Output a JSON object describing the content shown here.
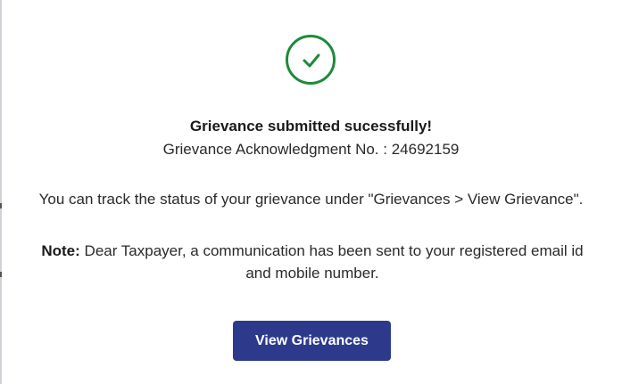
{
  "status": {
    "icon": "check-circle-icon",
    "accent_color": "#1e8a3a",
    "title": "Grievance submitted sucessfully!",
    "ack_label": "Grievance Acknowledgment No. :",
    "ack_number": "24692159"
  },
  "message": {
    "track_text": "You can track the status of your grievance under \"Grievances > View Grievance\".",
    "note_label": "Note:",
    "note_text": " Dear Taxpayer, a communication has been sent to your registered email id and mobile number."
  },
  "actions": {
    "view_label": "View Grievances",
    "button_color": "#2d3a8c"
  }
}
